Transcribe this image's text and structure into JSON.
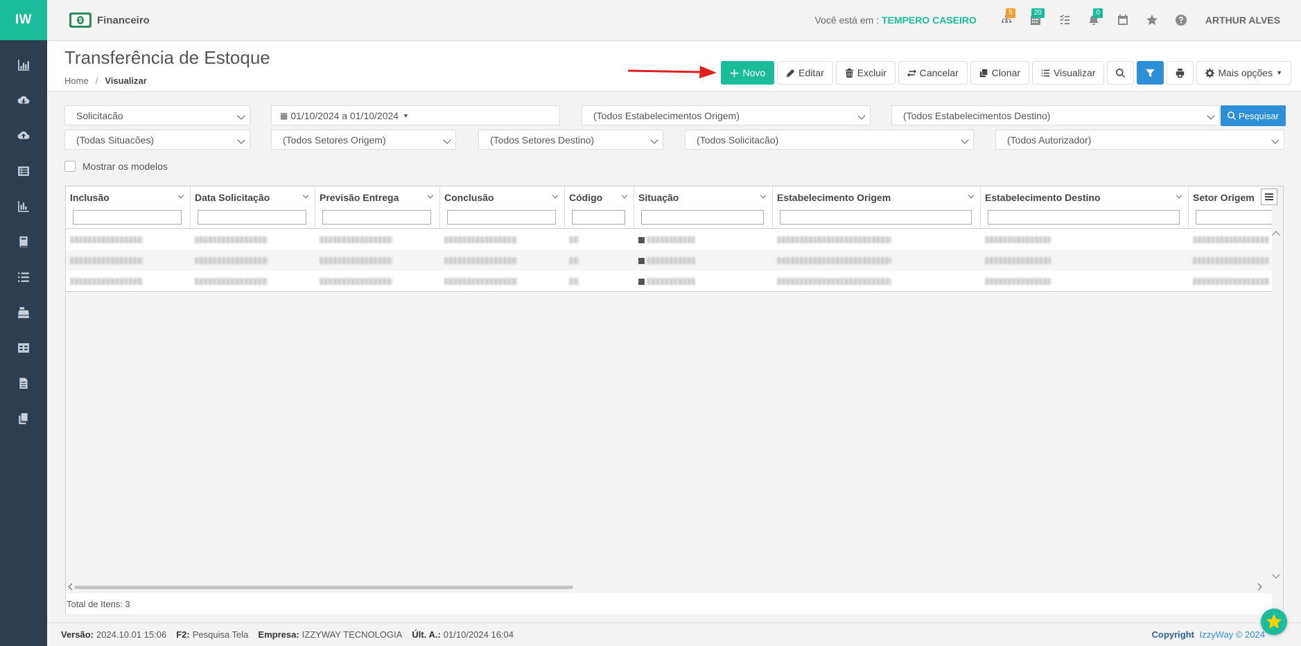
{
  "sidebar": {
    "logo": "IW",
    "icons": [
      "chart-bar-icon",
      "cloud-download-icon",
      "cloud-upload-icon",
      "list-alt-icon",
      "chart-area-icon",
      "book-icon",
      "list-icon",
      "cash-register-icon",
      "id-card-icon",
      "file-icon",
      "copy-icon"
    ]
  },
  "header": {
    "module": "Financeiro",
    "where_label": "Você está em :",
    "company": "TEMPERO CASEIRO",
    "badges": {
      "sitemap": "5",
      "calendar": "20",
      "bell": "0"
    },
    "badge_colors": {
      "sitemap": "#f0a030",
      "calendar": "#1abc9c",
      "bell": "#1abc9c"
    },
    "user": "ARTHUR ALVES"
  },
  "page": {
    "title": "Transferência de Estoque",
    "breadcrumb_home": "Home",
    "breadcrumb_current": "Visualizar"
  },
  "toolbar": {
    "novo": "Novo",
    "editar": "Editar",
    "excluir": "Excluir",
    "cancelar": "Cancelar",
    "clonar": "Clonar",
    "visualizar": "Visualizar",
    "mais": "Mais opções"
  },
  "filters": {
    "tipo": "Solicitacão",
    "periodo": "01/10/2024 a 01/10/2024",
    "estab_origem": "(Todos Estabelecimentos Origem)",
    "estab_destino": "(Todos Estabelecimentos Destino)",
    "pesquisar": "Pesquisar",
    "situacoes": "(Todas Situacões)",
    "setores_origem": "(Todos Setores Origem)",
    "setores_destino": "(Todos Setores Destino)",
    "solicitacao": "(Todos Solicitacão)",
    "autorizador": "(Todos Autorizador)",
    "mostrar_modelos": "Mostrar os modelos"
  },
  "grid": {
    "columns": [
      "Inclusão",
      "Data Solicitação",
      "Previsão Entrega",
      "Conclusão",
      "Código",
      "Situação",
      "Estabelecimento Origem",
      "Estabelecimento Destino",
      "Setor Origem"
    ],
    "row_count": 3,
    "total_label": "Total de Itens: 3"
  },
  "footer": {
    "versao_label": "Versão:",
    "versao": "2024.10.01 15:06",
    "f2_label": "F2:",
    "f2": "Pesquisa Tela",
    "empresa_label": "Empresa:",
    "empresa": "IZZYWAY TECNOLOGIA",
    "ult_label": "Últ. A.:",
    "ult": "01/10/2024 16:04",
    "copyright_label": "Copyright",
    "copyright": "IzzyWay © 2024"
  },
  "colors": {
    "accent": "#1abc9c",
    "sidebar": "#2c3e50",
    "primary_blue": "#2d8fd5",
    "arrow": "#e02020"
  }
}
